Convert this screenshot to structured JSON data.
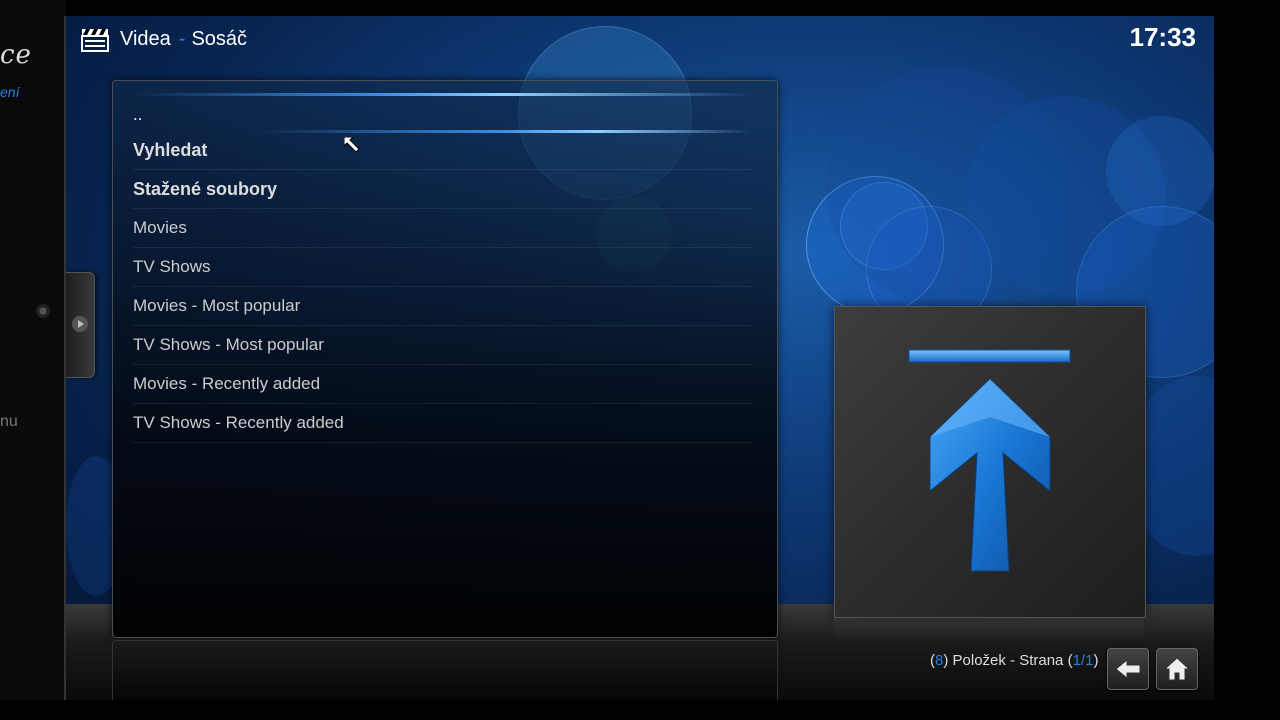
{
  "side_panel": {
    "logo_fragment": "ce",
    "link_fragment": "ení",
    "menu_fragment": "nu"
  },
  "header": {
    "section": "Videa",
    "separator": "-",
    "addon": "Sosáč",
    "icon": "clapperboard-icon"
  },
  "clock": "17:33",
  "list": {
    "items": [
      {
        "label": "..",
        "style": "parent",
        "focused": true
      },
      {
        "label": "Vyhledat",
        "style": "bold"
      },
      {
        "label": "Stažené soubory",
        "style": "bold"
      },
      {
        "label": "Movies",
        "style": "normal"
      },
      {
        "label": "TV Shows",
        "style": "normal"
      },
      {
        "label": "Movies - Most popular",
        "style": "normal"
      },
      {
        "label": "TV Shows - Most popular",
        "style": "normal"
      },
      {
        "label": "Movies - Recently added",
        "style": "normal"
      },
      {
        "label": "TV Shows - Recently added",
        "style": "normal"
      }
    ]
  },
  "thumbnail": {
    "icon": "folder-up-arrow-icon"
  },
  "footer": {
    "paren_open": "(",
    "item_count": "8",
    "paren_close": ")",
    "items_label": " Položek - Strana ",
    "page_open": "(",
    "page_current": "1",
    "page_sep": "/",
    "page_total": "1",
    "page_close": ")",
    "back_icon": "back-arrow-icon",
    "home_icon": "home-icon"
  },
  "colors": {
    "accent": "#2a7de1",
    "background_blue": "#0e3b78",
    "arrow_blue": "#1a78d6"
  }
}
